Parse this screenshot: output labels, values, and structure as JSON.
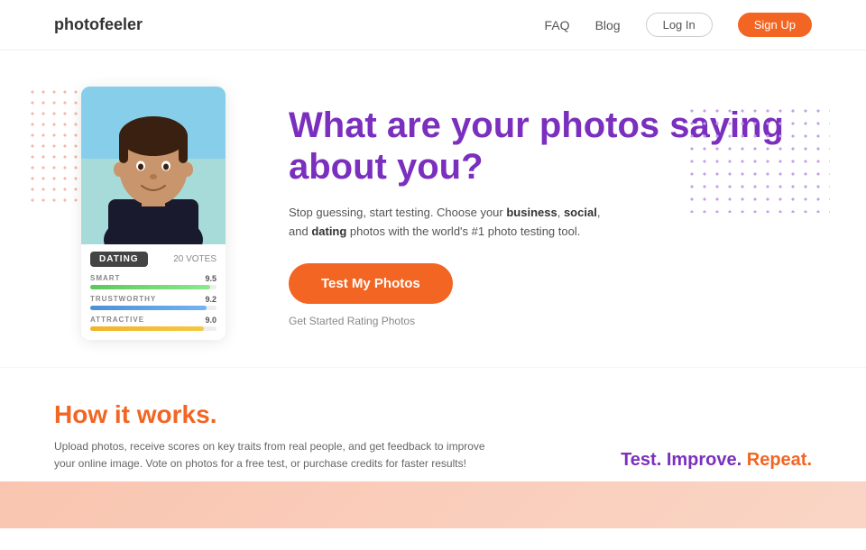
{
  "nav": {
    "logo": "photofeeler",
    "links": [
      "FAQ",
      "Blog"
    ],
    "login_label": "Log In",
    "signup_label": "Sign Up"
  },
  "hero": {
    "title": "What are your photos saying about you?",
    "description_plain": "Stop guessing, start testing. Choose your ",
    "description_bold1": "business",
    "description_mid": ", ",
    "description_bold2": "social",
    "description_end": ", and ",
    "description_bold3": "dating",
    "description_tail": " photos with the world's #1 photo testing tool.",
    "cta_label": "Test My Photos",
    "get_started": "Get Started Rating Photos",
    "tab_label": "DATING",
    "votes_count": "20",
    "votes_label": "VOTES",
    "stats": [
      {
        "label": "SMART",
        "score": "9.5",
        "pct": 95,
        "type": "green"
      },
      {
        "label": "TRUSTWORTHY",
        "score": "9.2",
        "pct": 92,
        "type": "blue"
      },
      {
        "label": "ATTRACTIVE",
        "score": "9.0",
        "pct": 90,
        "type": "orange"
      }
    ]
  },
  "how": {
    "title": "How it works.",
    "description": "Upload photos, receive scores on key traits from real people, and get feedback to improve your online image. Vote on photos for a free test, or purchase credits for faster results!",
    "test_improve": "Test. Improve. Repeat."
  }
}
